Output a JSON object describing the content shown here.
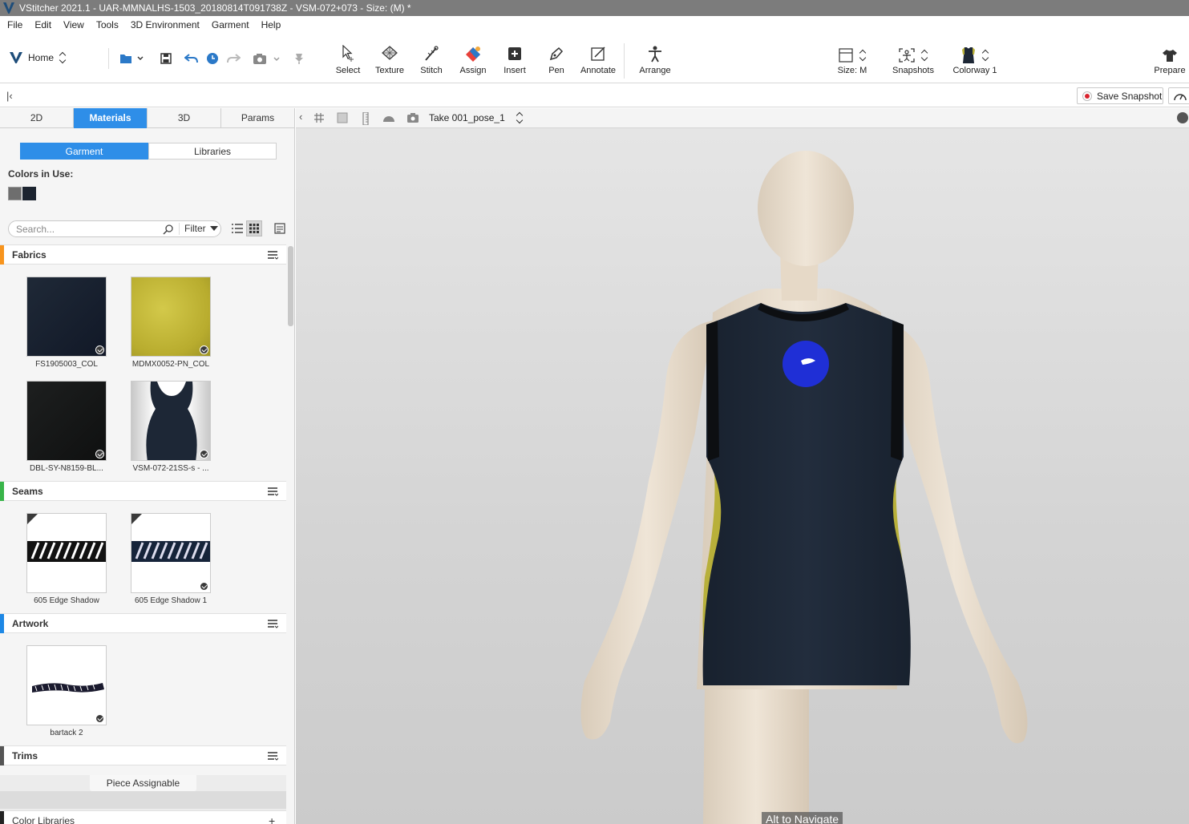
{
  "window": {
    "title": "VStitcher 2021.1 - UAR-MMNALHS-1503_20180814T091738Z - VSM-072+073 - Size: (M) *"
  },
  "menu": [
    "File",
    "Edit",
    "View",
    "Tools",
    "3D Environment",
    "Garment",
    "Help"
  ],
  "home": {
    "label": "Home"
  },
  "quick_icons": [
    "folder-icon",
    "save-icon",
    "undo-icon",
    "history-icon",
    "redo-icon",
    "camera-icon",
    "pin-icon"
  ],
  "tools": [
    {
      "label": "Select",
      "icon": "select-icon"
    },
    {
      "label": "Texture",
      "icon": "texture-icon"
    },
    {
      "label": "Stitch",
      "icon": "stitch-icon"
    },
    {
      "label": "Assign",
      "icon": "assign-icon"
    },
    {
      "label": "Insert",
      "icon": "insert-icon"
    },
    {
      "label": "Pen",
      "icon": "pen-icon"
    },
    {
      "label": "Annotate",
      "icon": "annotate-icon"
    },
    {
      "label": "Arrange",
      "icon": "arrange-icon"
    }
  ],
  "right_tools": {
    "size": "Size: M",
    "snapshots": "Snapshots",
    "colorway": "Colorway 1",
    "prepare": "Prepare"
  },
  "secbar": {
    "save_snapshot": "Save Snapshot"
  },
  "left_tabs": [
    "2D",
    "Materials",
    "3D",
    "Params"
  ],
  "active_tab": "Materials",
  "segments": {
    "garment": "Garment",
    "libraries": "Libraries"
  },
  "colors_in_use": {
    "label": "Colors in Use:",
    "swatches": [
      "#6e6e6e",
      "#1c2430"
    ]
  },
  "search": {
    "placeholder": "Search...",
    "filter": "Filter"
  },
  "sections": {
    "fabrics": {
      "label": "Fabrics",
      "accent": "#f7941d"
    },
    "seams": {
      "label": "Seams",
      "accent": "#39b54a"
    },
    "artwork": {
      "label": "Artwork",
      "accent": "#1e88e5"
    },
    "trims": {
      "label": "Trims",
      "accent": "#555555"
    },
    "color_libraries": {
      "label": "Color Libraries",
      "accent": "#222222"
    }
  },
  "fabrics": [
    {
      "name": "FS1905003_COL"
    },
    {
      "name": "MDMX0052-PN_COL"
    },
    {
      "name": "DBL-SY-N8159-BL..."
    },
    {
      "name": "VSM-072-21SS-s - ..."
    }
  ],
  "seams": [
    {
      "name": "605 Edge Shadow"
    },
    {
      "name": "605 Edge Shadow 1"
    }
  ],
  "artwork": [
    {
      "name": "bartack 2"
    }
  ],
  "piece_assignable": "Piece Assignable",
  "viewport": {
    "take": "Take 001_pose_1",
    "alt_navigate": "Alt to Navigate"
  },
  "garment_colors": {
    "body": "#1d2736",
    "panel": "#b8b03a",
    "skin": "#e9ddcd",
    "marker": "#1f2fd6"
  }
}
